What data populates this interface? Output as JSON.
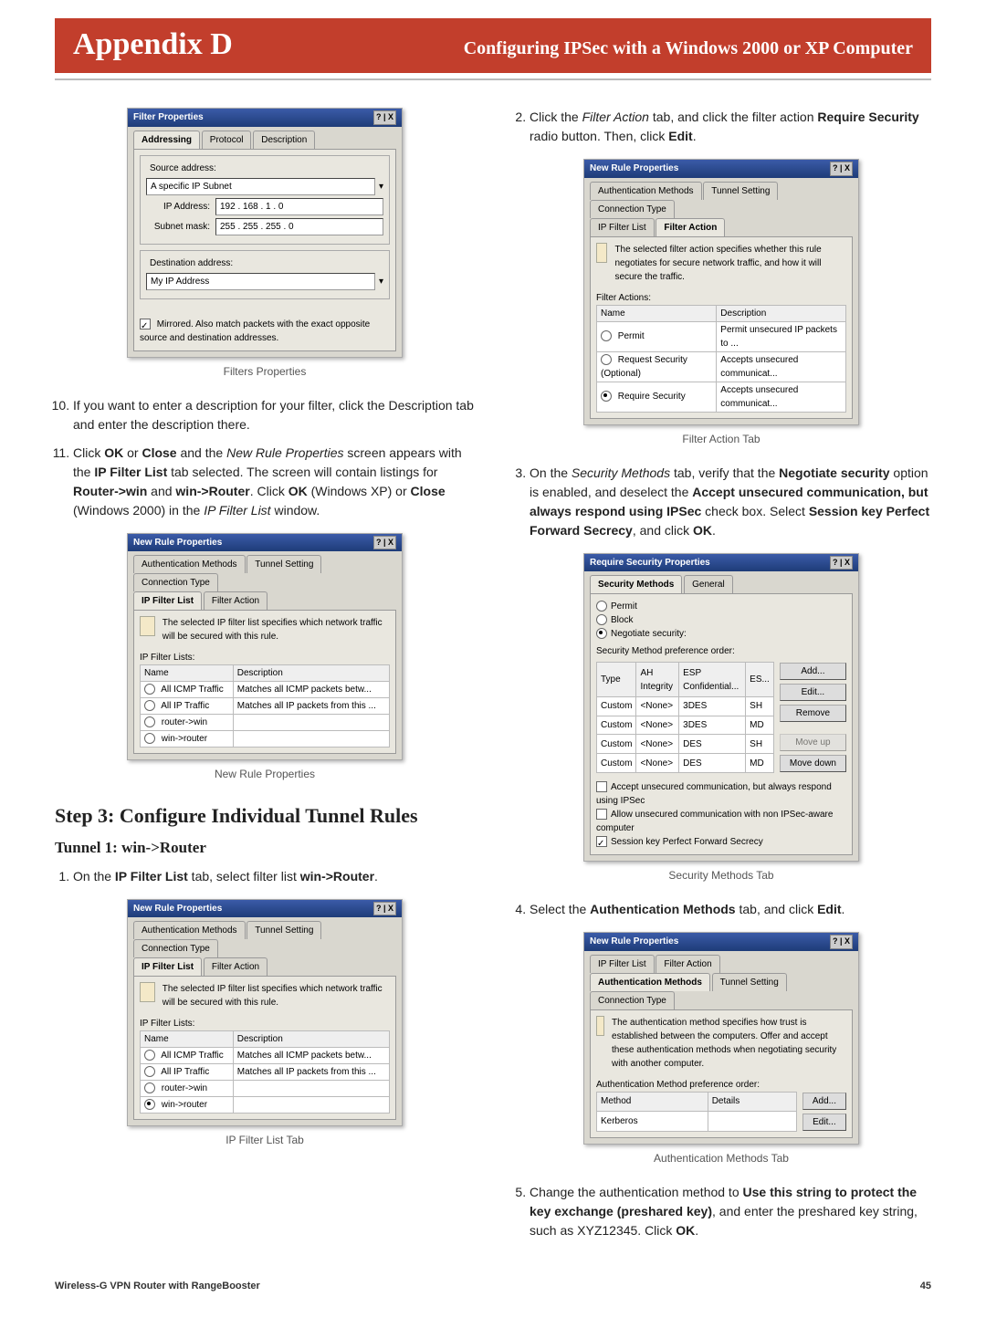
{
  "header": {
    "left": "Appendix D",
    "right": "Configuring IPSec with a Windows 2000  or XP Computer"
  },
  "left_col": {
    "fig1": {
      "title": "Filter Properties",
      "tabs": [
        "Addressing",
        "Protocol",
        "Description"
      ],
      "source_group": "Source address:",
      "source_select": "A specific IP Subnet",
      "ip_label": "IP Address:",
      "ip_value": "192 . 168 .   1 .   0",
      "mask_label": "Subnet mask:",
      "mask_value": "255 . 255 . 255 .   0",
      "dest_group": "Destination address:",
      "dest_select": "My IP Address",
      "mirrored": "Mirrored. Also match packets with the exact opposite source and destination addresses.",
      "caption": "Filters Properties"
    },
    "step10": "If you want to enter a description for your filter, click the Description tab and enter the description there.",
    "step11_a": "Click ",
    "step11_ok": "OK",
    "step11_b": " or ",
    "step11_close": "Close",
    "step11_c": " and the ",
    "step11_i1": "New Rule Properties",
    "step11_d": " screen appears with the ",
    "step11_b2": "IP Filter List",
    "step11_e": " tab selected. The screen will contain listings for ",
    "step11_b3": "Router->win",
    "step11_f": " and ",
    "step11_b4": "win->Router",
    "step11_g": ". Click ",
    "step11_b5": "OK",
    "step11_h": " (Windows XP) or ",
    "step11_b6": "Close",
    "step11_i": " (Windows 2000) in the ",
    "step11_i2": "IP Filter List",
    "step11_j": " window.",
    "fig2": {
      "title": "New Rule Properties",
      "tabs_top": [
        "Authentication Methods",
        "Tunnel Setting",
        "Connection Type"
      ],
      "tabs_bot": [
        "IP Filter List",
        "Filter Action"
      ],
      "desc": "The selected IP filter list specifies which network traffic will be secured with this rule.",
      "list_label": "IP Filter Lists:",
      "cols": [
        "Name",
        "Description"
      ],
      "rows": [
        [
          "All ICMP Traffic",
          "Matches all ICMP packets betw..."
        ],
        [
          "All IP Traffic",
          "Matches all IP packets from this ..."
        ],
        [
          "router->win",
          ""
        ],
        [
          "win->router",
          ""
        ]
      ],
      "selected_row": -1,
      "caption": "New Rule Properties"
    },
    "h2": "Step 3: Configure Individual Tunnel Rules",
    "h3": "Tunnel 1: win->Router",
    "step1_a": "On the ",
    "step1_b1": "IP Filter List",
    "step1_b": " tab, select filter list ",
    "step1_b2": "win->Router",
    "step1_c": ".",
    "fig3": {
      "title": "New Rule Properties",
      "tabs_top": [
        "Authentication Methods",
        "Tunnel Setting",
        "Connection Type"
      ],
      "tabs_bot": [
        "IP Filter List",
        "Filter Action"
      ],
      "desc": "The selected IP filter list specifies which network traffic will be secured with this rule.",
      "list_label": "IP Filter Lists:",
      "cols": [
        "Name",
        "Description"
      ],
      "rows": [
        [
          "All ICMP Traffic",
          "Matches all ICMP packets betw..."
        ],
        [
          "All IP Traffic",
          "Matches all IP packets from this ..."
        ],
        [
          "router->win",
          ""
        ],
        [
          "win->router",
          ""
        ]
      ],
      "selected_row": 3,
      "caption": "IP Filter List Tab"
    }
  },
  "right_col": {
    "step2_a": "Click the ",
    "step2_i1": "Filter Action",
    "step2_b": " tab, and click the filter action ",
    "step2_b1": "Require Security",
    "step2_c": " radio button. Then, click ",
    "step2_b2": "Edit",
    "step2_d": ".",
    "fig4": {
      "title": "New Rule Properties",
      "tabs_top": [
        "Authentication Methods",
        "Tunnel Setting",
        "Connection Type"
      ],
      "tabs_bot": [
        "IP Filter List",
        "Filter Action"
      ],
      "desc": "The selected filter action specifies whether this rule negotiates for secure network traffic, and how it will secure the traffic.",
      "list_label": "Filter Actions:",
      "cols": [
        "Name",
        "Description"
      ],
      "rows": [
        [
          "Permit",
          "Permit unsecured IP packets to ..."
        ],
        [
          "Request Security (Optional)",
          "Accepts unsecured communicat..."
        ],
        [
          "Require Security",
          "Accepts unsecured communicat..."
        ]
      ],
      "selected_row": 2,
      "caption": "Filter Action Tab"
    },
    "step3_a": "On the ",
    "step3_i1": "Security Methods",
    "step3_b": " tab, verify that the ",
    "step3_b1": "Negotiate security",
    "step3_c": " option is enabled, and deselect the ",
    "step3_b2": "Accept unsecured communication, but always respond using IPSec",
    "step3_d": " check box. Select ",
    "step3_b3": "Session key Perfect Forward Secrecy",
    "step3_e": ", and click ",
    "step3_b4": "OK",
    "step3_f": ".",
    "fig5": {
      "title": "Require Security Properties",
      "tabs": [
        "Security Methods",
        "General"
      ],
      "opt_permit": "Permit",
      "opt_block": "Block",
      "opt_neg": "Negotiate security:",
      "order_label": "Security Method preference order:",
      "cols": [
        "Type",
        "AH Integrity",
        "ESP Confidential...",
        "ES..."
      ],
      "rows": [
        [
          "Custom",
          "<None>",
          "3DES",
          "SH"
        ],
        [
          "Custom",
          "<None>",
          "3DES",
          "MD"
        ],
        [
          "Custom",
          "<None>",
          "DES",
          "SH"
        ],
        [
          "Custom",
          "<None>",
          "DES",
          "MD"
        ]
      ],
      "btns": [
        "Add...",
        "Edit...",
        "Remove",
        "Move up",
        "Move down"
      ],
      "chk1": "Accept unsecured communication, but always respond using IPSec",
      "chk2": "Allow unsecured communication with non IPSec-aware computer",
      "chk3": "Session key Perfect Forward Secrecy",
      "caption": "Security Methods Tab"
    },
    "step4_a": "Select the ",
    "step4_b1": "Authentication Methods",
    "step4_b": " tab, and click ",
    "step4_b2": "Edit",
    "step4_c": ".",
    "fig6": {
      "title": "New Rule Properties",
      "tabs_top": [
        "IP Filter List",
        "Filter Action"
      ],
      "tabs_bot": [
        "Authentication Methods",
        "Tunnel Setting",
        "Connection Type"
      ],
      "desc": "The authentication method specifies how trust is established between the computers. Offer and accept these authentication methods when negotiating security with another computer.",
      "order_label": "Authentication Method preference order:",
      "cols": [
        "Method",
        "Details"
      ],
      "rows": [
        [
          "Kerberos",
          ""
        ]
      ],
      "btns": [
        "Add...",
        "Edit..."
      ],
      "caption": "Authentication Methods Tab"
    },
    "step5_a": "Change the authentication method to ",
    "step5_b1": "Use this string to protect the key exchange (preshared key)",
    "step5_b": ", and enter the preshared key string, such as XYZ12345. Click ",
    "step5_b2": "OK",
    "step5_c": "."
  },
  "footer": {
    "product": "Wireless-G VPN Router with RangeBooster",
    "page": "45"
  }
}
